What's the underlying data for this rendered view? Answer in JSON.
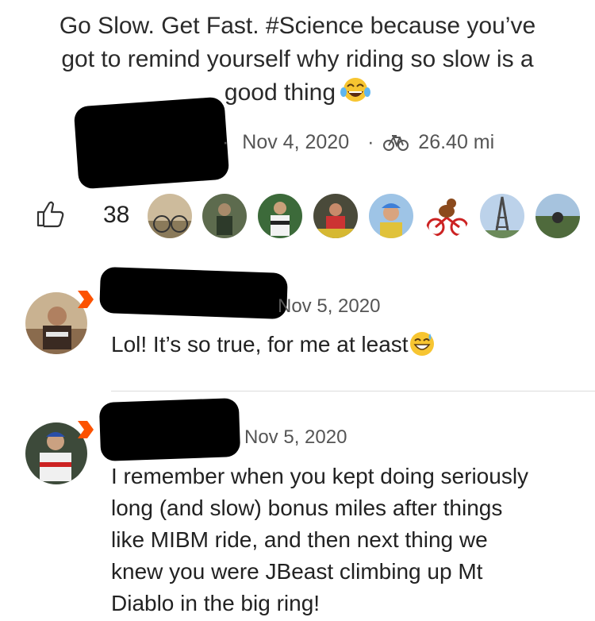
{
  "post": {
    "title_line1": "Go Slow. Get Fast. #Science because you’ve",
    "title_line2": "got to remind yourself why riding so slow is a",
    "title_line3": "good thing",
    "separator": "·",
    "date": "Nov 4, 2020",
    "distance": "26.40 mi"
  },
  "kudos": {
    "count": "38",
    "avatars": [
      "kudo-avatar-1",
      "kudo-avatar-2",
      "kudo-avatar-3",
      "kudo-avatar-4",
      "kudo-avatar-5",
      "kudo-avatar-6",
      "kudo-avatar-7",
      "kudo-avatar-8"
    ]
  },
  "comments": [
    {
      "date": "Nov 5, 2020",
      "text": "Lol! It’s so true, for me at least"
    },
    {
      "date": "Nov 5, 2020",
      "lines": [
        "I remember when you kept doing seriously",
        "long (and slow) bonus miles after things",
        "like MIBM ride, and then next thing we",
        "knew you were JBeast climbing up Mt",
        "Diablo in the big ring!"
      ]
    }
  ],
  "colors": {
    "accent": "#fc5200",
    "muted": "#555555",
    "text": "#222222"
  }
}
